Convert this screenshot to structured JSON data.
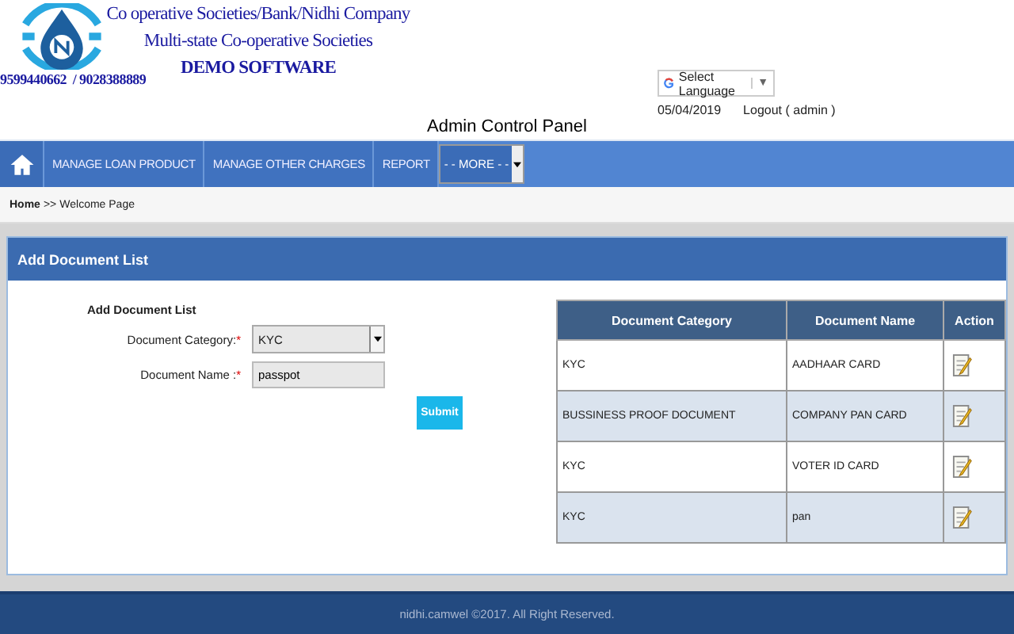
{
  "header": {
    "title_lines": [
      "Co operative Societies/Bank/Nidhi Company",
      "Multi-state Co-operative Societies",
      "DEMO SOFTWARE"
    ],
    "phone": "9599440662  / 9028388889",
    "language_select": {
      "value": "Select Language",
      "arrow": "▼"
    },
    "date": "05/04/2019",
    "logout": "Logout ( admin )",
    "panel_title": "Admin Control Panel"
  },
  "nav": {
    "items": [
      "MANAGE LOAN PRODUCT",
      "MANAGE OTHER CHARGES",
      "REPORT"
    ],
    "more_select": "- - MORE - -"
  },
  "breadcrumb": {
    "home": "Home",
    "separator": ">>",
    "current": "Welcome Page"
  },
  "panel": {
    "title": "Add Document List",
    "form": {
      "heading": "Add Document List",
      "fields": [
        {
          "kind": "select",
          "label": "Document Category:",
          "required_mark": "*",
          "value": "KYC"
        },
        {
          "kind": "text",
          "label": "Document Name :",
          "required_mark": "*",
          "value": "passpot"
        }
      ],
      "submit": "Submit"
    },
    "table": {
      "columns": [
        "Document Category",
        "Document Name",
        "Action"
      ],
      "rows": [
        {
          "category": "KYC",
          "name": "AADHAAR CARD"
        },
        {
          "category": "BUSSINESS PROOF DOCUMENT",
          "name": "COMPANY PAN CARD"
        },
        {
          "category": "KYC",
          "name": "VOTER ID CARD"
        },
        {
          "category": "KYC",
          "name": "pan"
        }
      ]
    }
  },
  "footer": "nidhi.camwel ©2017. All Right Reserved."
}
